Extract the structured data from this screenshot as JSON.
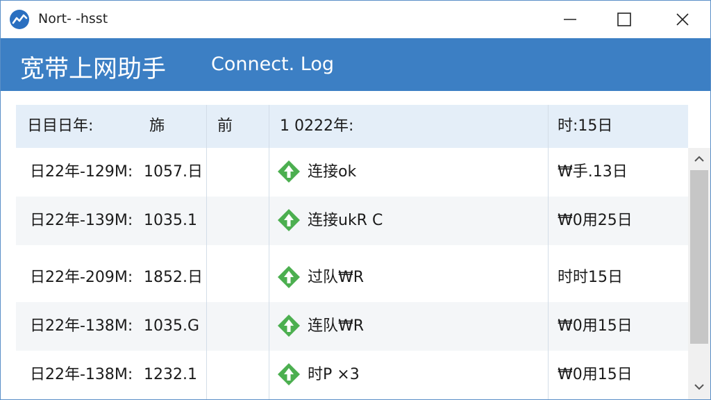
{
  "window": {
    "title": "Nort- -hsst"
  },
  "header": {
    "title": "宽带上网助手",
    "subtitle": "Connect. Log"
  },
  "table": {
    "columns": [
      "日目日年:",
      "旆",
      "前",
      "1 0222年:",
      "时:15日"
    ],
    "rows": [
      {
        "date": "日22年-129M:",
        "value": "1057.日",
        "status": "连接ok",
        "time": "₩手.13日"
      },
      {
        "date": "日22年-139M:",
        "value": "1035.1",
        "status": "连接ukR C",
        "time": "₩0用25日"
      },
      {
        "date": "日22年-209M:",
        "value": "1852.日",
        "status": "过队₩R",
        "time": "时时15日"
      },
      {
        "date": "日22年-138M:",
        "value": "1035.G",
        "status": "连队₩R",
        "time": "₩0用15日"
      },
      {
        "date": "日22年-138M:",
        "value": "1232.1",
        "status": "时P ×3",
        "time": "₩0用15日"
      }
    ]
  },
  "icons": {
    "app": "app-chart-icon",
    "status": "diamond-arrow-up-icon",
    "minimize": "minimize-icon",
    "maximize": "maximize-icon",
    "close": "close-icon"
  },
  "colors": {
    "header": "#3c7fc4",
    "status_green": "#4caf50",
    "table_header": "#e4eef8"
  }
}
